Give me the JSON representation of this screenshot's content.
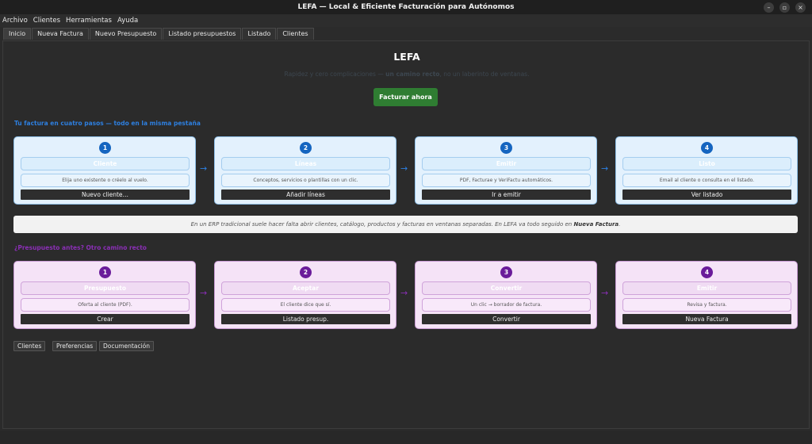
{
  "window": {
    "title": "LEFA — Local & Eficiente Facturación para Autónomos",
    "controls": [
      "–",
      "▫",
      "×"
    ]
  },
  "menu": [
    "Archivo",
    "Clientes",
    "Herramientas",
    "Ayuda"
  ],
  "tabs": [
    "Inicio",
    "Nueva Factura",
    "Nuevo Presupuesto",
    "Listado presupuestos",
    "Listado",
    "Clientes"
  ],
  "active_tab": "Inicio",
  "home": {
    "title": "LEFA",
    "tagline_pre": "Rapidez y cero complicaciones — ",
    "tagline_bold": "un camino recto",
    "tagline_post": ", no un laberinto de ventanas.",
    "cta": "Facturar ahora"
  },
  "invoice_flow": {
    "label": "Tu factura en cuatro pasos — todo en la misma pestaña",
    "steps": [
      {
        "num": "1",
        "title": "Cliente",
        "desc": "Elija uno existente o créelo al vuelo.",
        "button": "Nuevo cliente…"
      },
      {
        "num": "2",
        "title": "Líneas",
        "desc": "Conceptos, servicios o plantillas con un clic.",
        "button": "Añadir líneas"
      },
      {
        "num": "3",
        "title": "Emitir",
        "desc": "PDF, Facturae y VeriFactu automáticos.",
        "button": "Ir a emitir"
      },
      {
        "num": "4",
        "title": "Listo",
        "desc": "Email al cliente o consulta en el listado.",
        "button": "Ver listado"
      }
    ]
  },
  "info_banner": {
    "pre": "En un ERP tradicional suele hacer falta abrir clientes, catálogo, productos y facturas en ventanas separadas. En LEFA va todo seguido en ",
    "bold": "Nueva Factura",
    "post": "."
  },
  "quote_flow": {
    "label": "¿Presupuesto antes? Otro camino recto",
    "steps": [
      {
        "num": "1",
        "title": "Presupuesto",
        "desc": "Oferta al cliente (PDF).",
        "button": "Crear"
      },
      {
        "num": "2",
        "title": "Aceptar",
        "desc": "El cliente dice que sí.",
        "button": "Listado presup."
      },
      {
        "num": "3",
        "title": "Convertir",
        "desc": "Un clic → borrador de factura.",
        "button": "Convertir"
      },
      {
        "num": "4",
        "title": "Emitir",
        "desc": "Revisa y factura.",
        "button": "Nueva Factura"
      }
    ]
  },
  "footer_buttons": [
    "Clientes",
    "Preferencias",
    "Documentación"
  ],
  "colors": {
    "accent_green": "#2f7d32",
    "flow_blue": "#1565c0",
    "flow_purple": "#6a1b9a"
  }
}
